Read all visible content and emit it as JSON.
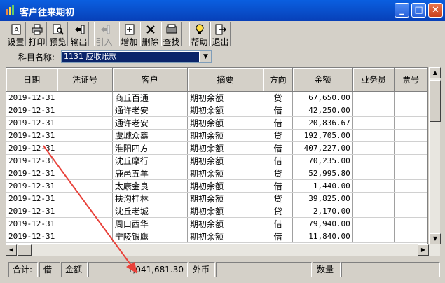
{
  "window": {
    "title": "客户往来期初",
    "minimize_glyph": "_",
    "maximize_glyph": "□",
    "close_glyph": "✕"
  },
  "toolbar": {
    "buttons": [
      {
        "label": "设置",
        "icon": "settings-icon",
        "enabled": true
      },
      {
        "label": "打印",
        "icon": "printer-icon",
        "enabled": true
      },
      {
        "label": "预览",
        "icon": "preview-icon",
        "enabled": true
      },
      {
        "label": "输出",
        "icon": "export-icon",
        "enabled": true
      },
      {
        "label": "引入",
        "icon": "import-icon",
        "enabled": false
      },
      {
        "label": "增加",
        "icon": "add-icon",
        "enabled": true
      },
      {
        "label": "删除",
        "icon": "delete-icon",
        "enabled": true
      },
      {
        "label": "查找",
        "icon": "find-icon",
        "enabled": true
      },
      {
        "label": "帮助",
        "icon": "help-icon",
        "enabled": true
      },
      {
        "label": "退出",
        "icon": "exit-icon",
        "enabled": true
      }
    ]
  },
  "subject": {
    "label": "科目名称:",
    "selected": "1131 应收账款"
  },
  "table": {
    "columns": [
      "日期",
      "凭证号",
      "客户",
      "摘要",
      "方向",
      "金额",
      "业务员",
      "票号"
    ],
    "rows": [
      [
        "2019-12-31",
        "",
        "商丘百通",
        "期初余额",
        "贷",
        "67,650.00",
        "",
        ""
      ],
      [
        "2019-12-31",
        "",
        "通许老安",
        "期初余额",
        "借",
        "42,250.00",
        "",
        ""
      ],
      [
        "2019-12-31",
        "",
        "通许老安",
        "期初余额",
        "借",
        "20,836.67",
        "",
        ""
      ],
      [
        "2019-12-31",
        "",
        "虞城众鑫",
        "期初余额",
        "贷",
        "192,705.00",
        "",
        ""
      ],
      [
        "2019-12-31",
        "",
        "淮阳四方",
        "期初余额",
        "借",
        "407,227.00",
        "",
        ""
      ],
      [
        "2019-12-31",
        "",
        "沈丘摩行",
        "期初余额",
        "借",
        "70,235.00",
        "",
        ""
      ],
      [
        "2019-12-31",
        "",
        "鹿邑五羊",
        "期初余额",
        "贷",
        "52,995.80",
        "",
        ""
      ],
      [
        "2019-12-31",
        "",
        "太康金良",
        "期初余额",
        "借",
        "1,440.00",
        "",
        ""
      ],
      [
        "2019-12-31",
        "",
        "扶沟桂林",
        "期初余额",
        "贷",
        "39,825.00",
        "",
        ""
      ],
      [
        "2019-12-31",
        "",
        "沈丘老城",
        "期初余额",
        "贷",
        "2,170.00",
        "",
        ""
      ],
      [
        "2019-12-31",
        "",
        "周口西华",
        "期初余额",
        "借",
        "79,940.00",
        "",
        ""
      ],
      [
        "2019-12-31",
        "",
        "宁陵银鹰",
        "期初余额",
        "借",
        "11,840.00",
        "",
        ""
      ]
    ]
  },
  "status": {
    "total_label": "合计:",
    "direction": "借",
    "amount_label": "金额",
    "amount": "1,041,681.30",
    "foreign_label": "外币",
    "foreign_value": "",
    "qty_label": "数量",
    "qty_value": ""
  },
  "colors": {
    "title_bar": "#0a5fe0",
    "selection": "#0a246a",
    "annotation_arrow": "#e8413a"
  }
}
